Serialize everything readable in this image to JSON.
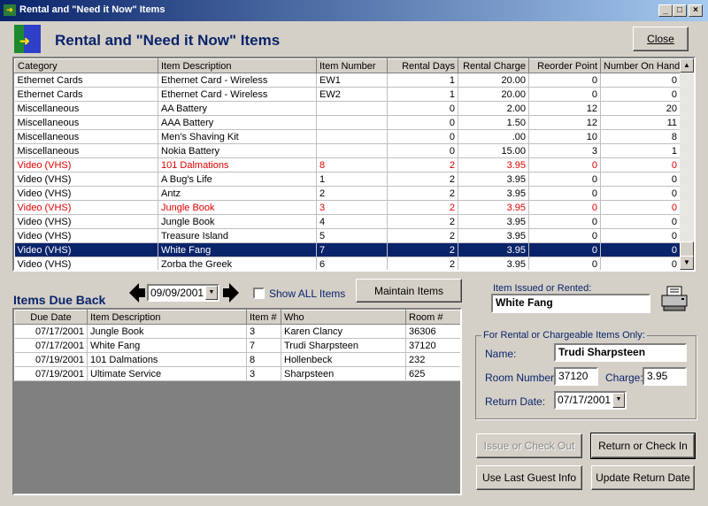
{
  "window": {
    "title": "Rental and \"Need it Now\" Items",
    "heading": "Rental and \"Need it Now\" Items",
    "min_glyph": "_",
    "max_glyph": "□",
    "close_glyph": "×"
  },
  "buttons": {
    "close": "Close",
    "maintain": "Maintain Items",
    "issue": "Issue or Check Out",
    "return": "Return or Check In",
    "last_guest": "Use Last Guest Info",
    "update_return": "Update Return Date"
  },
  "items_table": {
    "headers": [
      "Category",
      "Item Description",
      "Item Number",
      "Rental Days",
      "Rental Charge",
      "Reorder Point",
      "Number On Hand"
    ],
    "rows": [
      {
        "cat": "Ethernet Cards",
        "desc": "Ethernet Card - Wireless",
        "num": "EW1",
        "days": "1",
        "charge": "20.00",
        "reorder": "0",
        "onhand": "0",
        "style": ""
      },
      {
        "cat": "Ethernet Cards",
        "desc": "Ethernet Card - Wireless",
        "num": "EW2",
        "days": "1",
        "charge": "20.00",
        "reorder": "0",
        "onhand": "0",
        "style": ""
      },
      {
        "cat": "Miscellaneous",
        "desc": "AA Battery",
        "num": "",
        "days": "0",
        "charge": "2.00",
        "reorder": "12",
        "onhand": "20",
        "style": ""
      },
      {
        "cat": "Miscellaneous",
        "desc": "AAA Battery",
        "num": "",
        "days": "0",
        "charge": "1.50",
        "reorder": "12",
        "onhand": "11",
        "style": ""
      },
      {
        "cat": "Miscellaneous",
        "desc": "Men's Shaving Kit",
        "num": "",
        "days": "0",
        "charge": ".00",
        "reorder": "10",
        "onhand": "8",
        "style": ""
      },
      {
        "cat": "Miscellaneous",
        "desc": "Nokia Battery",
        "num": "",
        "days": "0",
        "charge": "15.00",
        "reorder": "3",
        "onhand": "1",
        "style": ""
      },
      {
        "cat": "Video (VHS)",
        "desc": "101 Dalmations",
        "num": "8",
        "days": "2",
        "charge": "3.95",
        "reorder": "0",
        "onhand": "0",
        "style": "red"
      },
      {
        "cat": "Video (VHS)",
        "desc": "A Bug's Life",
        "num": "1",
        "days": "2",
        "charge": "3.95",
        "reorder": "0",
        "onhand": "0",
        "style": ""
      },
      {
        "cat": "Video (VHS)",
        "desc": "Antz",
        "num": "2",
        "days": "2",
        "charge": "3.95",
        "reorder": "0",
        "onhand": "0",
        "style": ""
      },
      {
        "cat": "Video (VHS)",
        "desc": "Jungle Book",
        "num": "3",
        "days": "2",
        "charge": "3.95",
        "reorder": "0",
        "onhand": "0",
        "style": "red"
      },
      {
        "cat": "Video (VHS)",
        "desc": "Jungle Book",
        "num": "4",
        "days": "2",
        "charge": "3.95",
        "reorder": "0",
        "onhand": "0",
        "style": ""
      },
      {
        "cat": "Video (VHS)",
        "desc": "Treasure Island",
        "num": "5",
        "days": "2",
        "charge": "3.95",
        "reorder": "0",
        "onhand": "0",
        "style": ""
      },
      {
        "cat": "Video (VHS)",
        "desc": "White Fang",
        "num": "7",
        "days": "2",
        "charge": "3.95",
        "reorder": "0",
        "onhand": "0",
        "style": "sel"
      },
      {
        "cat": "Video (VHS)",
        "desc": "Zorba the Greek",
        "num": "6",
        "days": "2",
        "charge": "3.95",
        "reorder": "0",
        "onhand": "0",
        "style": ""
      }
    ]
  },
  "due_back": {
    "title": "Items Due Back",
    "date": "09/09/2001",
    "show_all_label": "Show ALL Items",
    "show_all_checked": false,
    "headers": [
      "Due Date",
      "Item Description",
      "Item #",
      "Who",
      "Room #"
    ],
    "rows": [
      {
        "due": "07/17/2001",
        "desc": "Jungle Book",
        "item": "3",
        "who": "Karen Clancy",
        "room": "36306"
      },
      {
        "due": "07/17/2001",
        "desc": "White Fang",
        "item": "7",
        "who": "Trudi Sharpsteen",
        "room": "37120"
      },
      {
        "due": "07/19/2001",
        "desc": "101 Dalmations",
        "item": "8",
        "who": "Hollenbeck",
        "room": "232"
      },
      {
        "due": "07/19/2001",
        "desc": "Ultimate Service",
        "item": "3",
        "who": "Sharpsteen",
        "room": "625"
      }
    ]
  },
  "issued": {
    "label": "Item Issued or Rented:",
    "value": "White Fang"
  },
  "rental_form": {
    "legend": "For Rental or Chargeable Items Only:",
    "name_label": "Name:",
    "name": "Trudi Sharpsteen",
    "room_label": "Room Number:",
    "room": "37120",
    "charge_label": "Charge:",
    "charge": "3.95",
    "return_label": "Return Date:",
    "return_date": "07/17/2001"
  },
  "colors": {
    "heading": "#0a246a",
    "selection": "#0a246a",
    "overdue_text": "#e00000",
    "window_face": "#d4d0c8"
  },
  "icons": [
    "app-icon",
    "printer-icon",
    "arrow-left-icon",
    "arrow-right-icon",
    "dropdown-arrow-icon",
    "scroll-up-icon",
    "scroll-down-icon"
  ]
}
